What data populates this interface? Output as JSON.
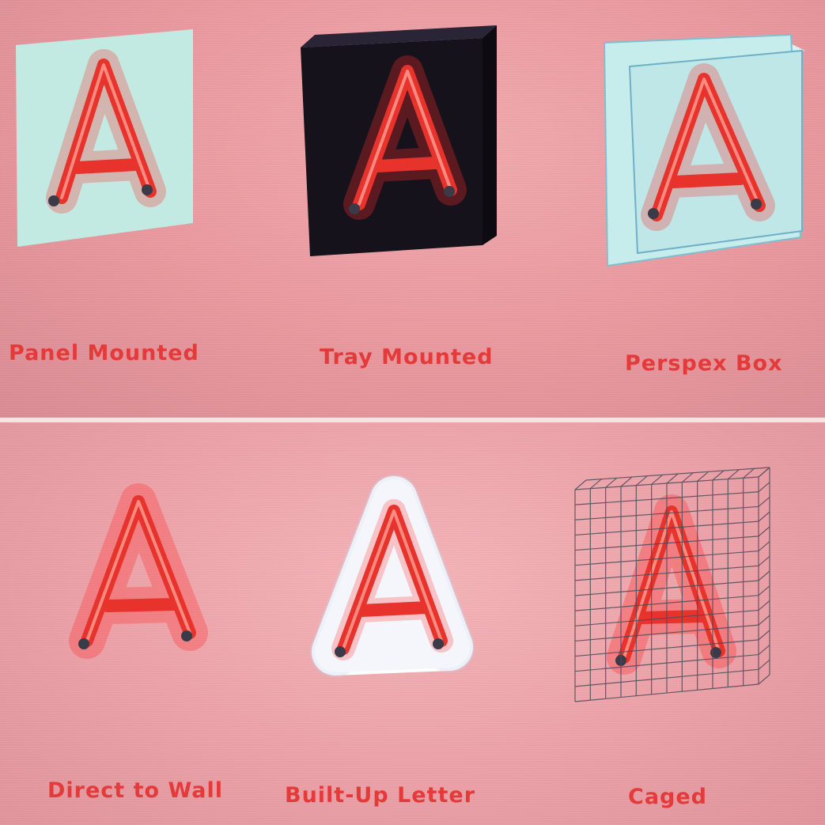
{
  "options": [
    {
      "label": "Panel Mounted",
      "letter": "A"
    },
    {
      "label": "Tray Mounted",
      "letter": "A"
    },
    {
      "label": "Perspex Box",
      "letter": "A"
    },
    {
      "label": "Direct to Wall",
      "letter": "A"
    },
    {
      "label": "Built-Up Letter",
      "letter": "A"
    },
    {
      "label": "Caged",
      "letter": "A"
    }
  ],
  "colors": {
    "neon_red": "#e8322c",
    "label_red": "#e53a3a",
    "panel_mint": "#bfe8e0",
    "tray_black": "#15121c",
    "perspex_blue": "#c6ecec"
  },
  "icons": [
    "neon-letter-a-icon",
    "standoff-fixing-icon",
    "wire-cage-icon"
  ]
}
